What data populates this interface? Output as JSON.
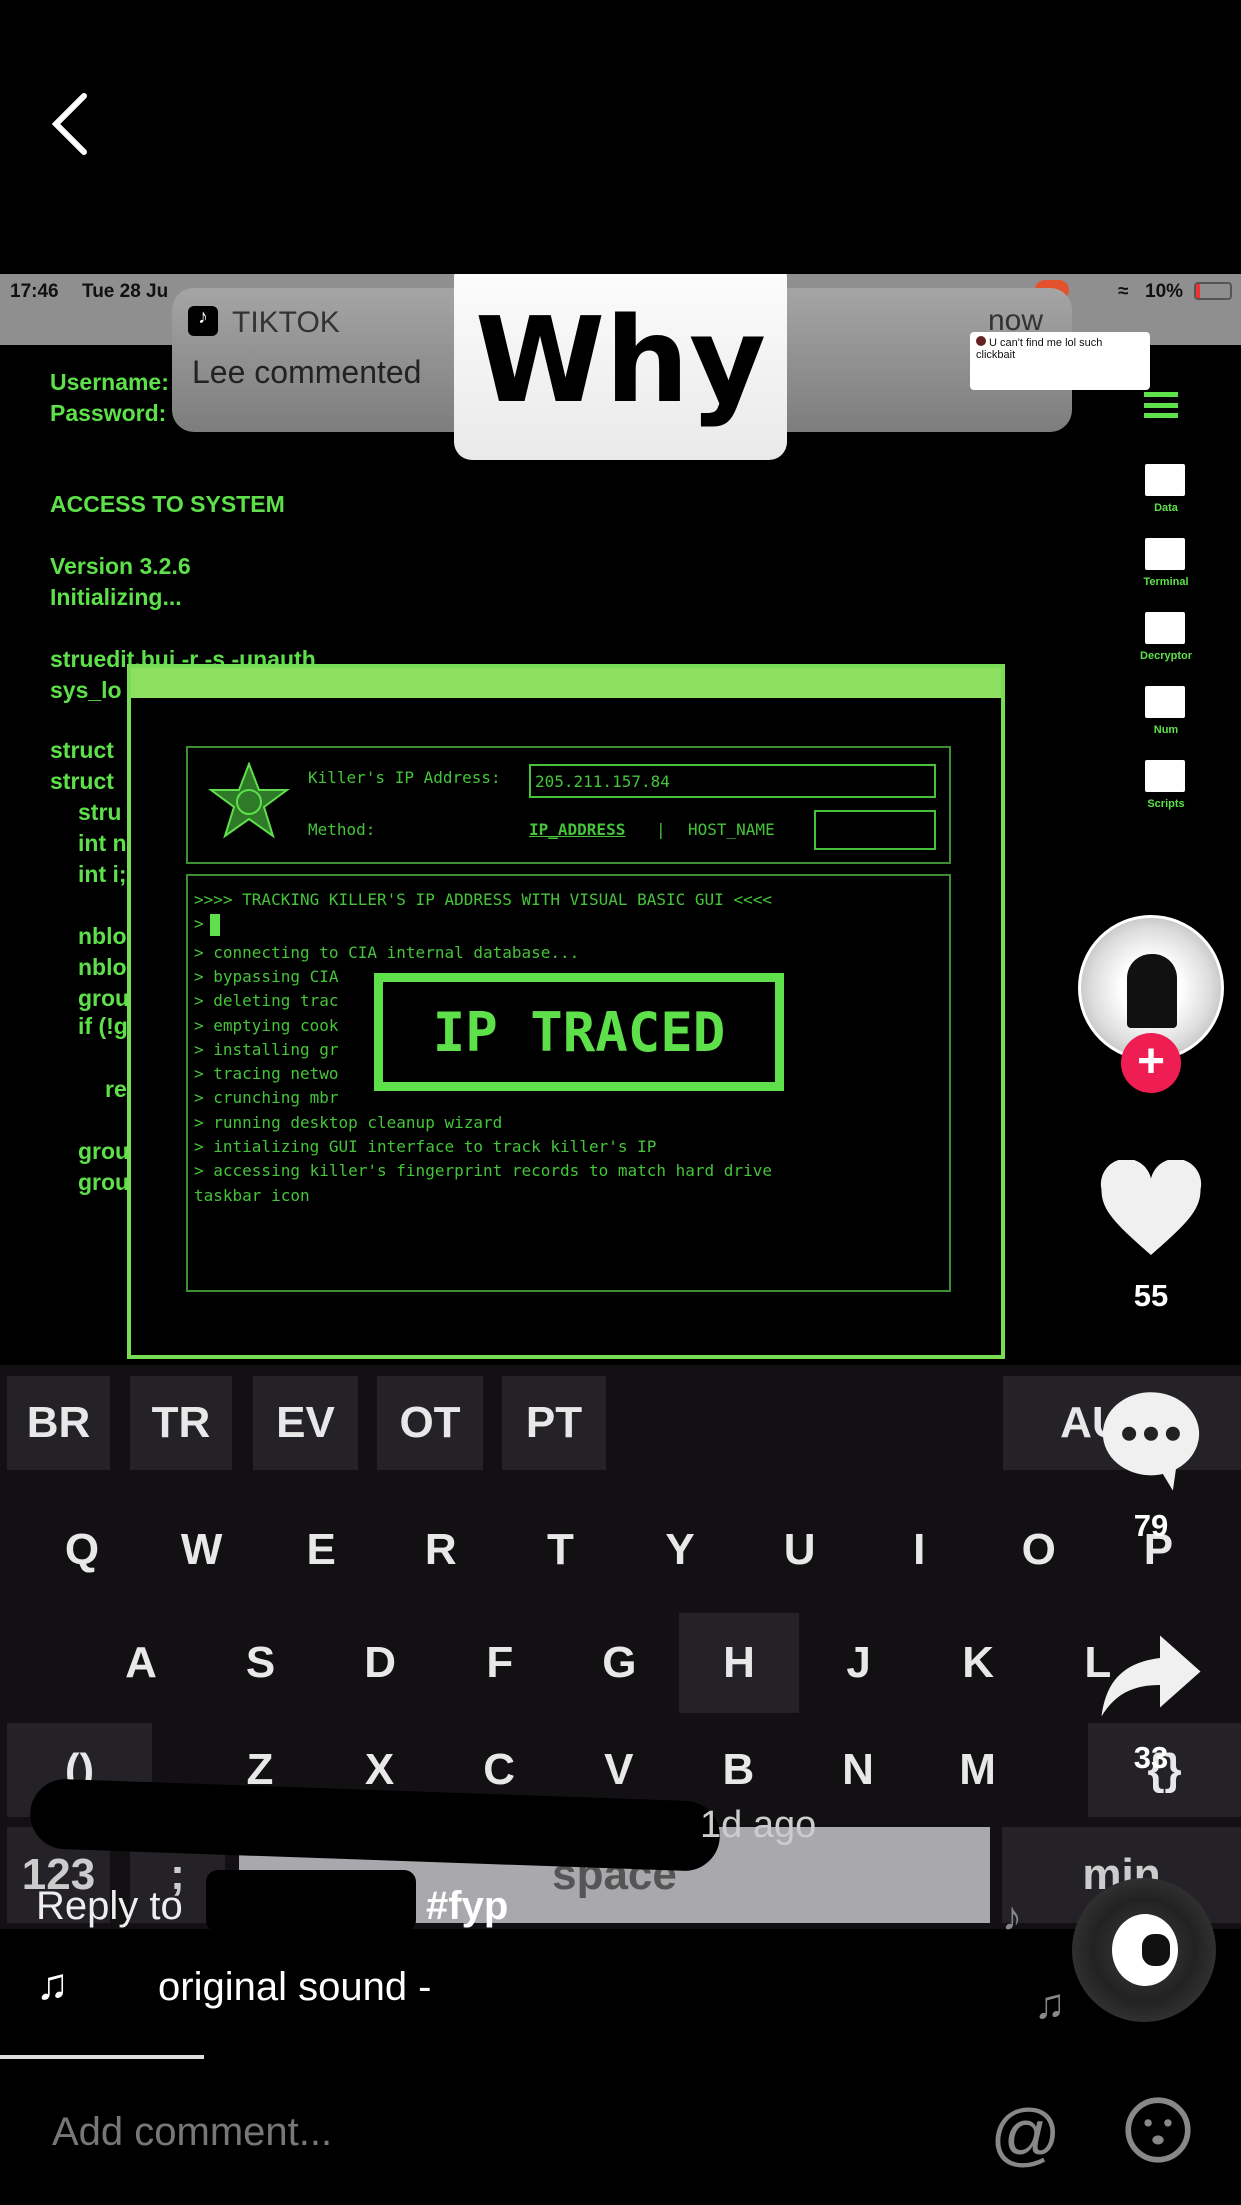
{
  "nav": {
    "back_icon": "chevron-left-icon"
  },
  "video": {
    "status": {
      "time": "17:46",
      "date": "Tue 28 Ju",
      "battery": "10%"
    },
    "notification": {
      "app": "TIKTOK",
      "text": "Lee commented",
      "time": "now",
      "preview": "U can't find me lol such clickbait"
    },
    "caption_overlay": "Why",
    "code_lines": [
      "Username:",
      "Password:",
      "ACCESS TO SYSTEM",
      "Version 3.2.6",
      "Initializing...",
      "struedit.bui -r -s -unauth",
      "sys_lo",
      "struct",
      "struct",
      "stru",
      "int n",
      "int i;",
      "nblo",
      "nblo",
      "grou",
      "if (!g",
      "re",
      "grou",
      "grou"
    ],
    "folders": [
      "Data",
      "Terminal",
      "Decryptor",
      "Num",
      "Scripts"
    ],
    "tracker": {
      "ip_label": "Killer's IP Address:",
      "ip_value": "205.211.157.84",
      "method_label": "Method:",
      "method_selected": "IP_ADDRESS",
      "separator": "|",
      "method_other": "HOST_NAME",
      "terminal": [
        ">>>> TRACKING KILLER'S IP ADDRESS WITH VISUAL BASIC GUI <<<<",
        ">",
        "> connecting to CIA internal database...",
        "> bypassing CIA",
        "> deleting trac",
        "> emptying cook",
        "> installing gr",
        "> tracing netwo",
        "> crunching mbr",
        "> running desktop cleanup wizard",
        "> intializing GUI interface to track killer's IP",
        "> accessing killer's fingerprint records to match hard drive",
        "taskbar icon"
      ],
      "banner": "IP TRACED"
    },
    "keyboard": {
      "top": [
        "BR",
        "TR",
        "EV",
        "OT",
        "PT",
        "AUTO"
      ],
      "row1": [
        "Q",
        "W",
        "E",
        "R",
        "T",
        "Y",
        "U",
        "I",
        "O",
        "P"
      ],
      "row2": [
        "A",
        "S",
        "D",
        "F",
        "G",
        "H",
        "J",
        "K",
        "L"
      ],
      "row3": [
        "()",
        "Z",
        "X",
        "C",
        "V",
        "B",
        "N",
        "M",
        "{}"
      ],
      "row4": [
        "123",
        ";",
        "space",
        "min"
      ]
    }
  },
  "actions": {
    "likes": "55",
    "comments": "79",
    "shares": "33"
  },
  "post": {
    "time_ago": "1d ago",
    "reply_prefix": "Reply to",
    "hashtag": "#fyp",
    "sound": "original sound -"
  },
  "comment_bar": {
    "placeholder": "Add comment...",
    "mention_icon": "at-icon",
    "emoji_icon": "emoji-icon"
  },
  "colors": {
    "terminal_green": "#5ee04a",
    "follow_red": "#ee1d52"
  }
}
